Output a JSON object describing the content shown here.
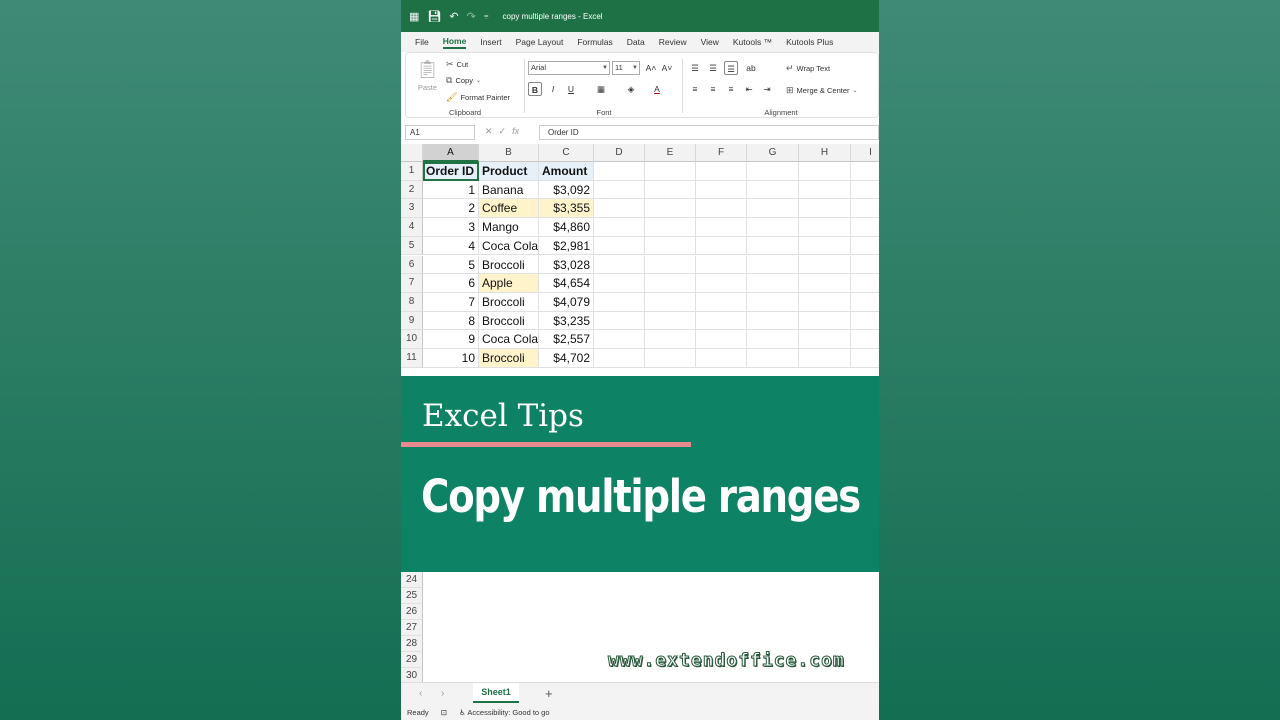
{
  "app": {
    "doc_title": "copy multiple ranges",
    "app_name": "Excel",
    "title_sep": "-"
  },
  "ribbon": {
    "tabs": [
      "File",
      "Home",
      "Insert",
      "Page Layout",
      "Formulas",
      "Data",
      "Review",
      "View",
      "Kutools ™",
      "Kutools Plus"
    ],
    "active_tab": "Home",
    "clipboard": {
      "paste": "Paste",
      "cut": "Cut",
      "copy": "Copy",
      "format_painter": "Format Painter",
      "label": "Clipboard"
    },
    "font": {
      "name": "Arial",
      "size": "11",
      "label": "Font",
      "bold": "B",
      "italic": "I",
      "underline": "U"
    },
    "alignment": {
      "wrap_text": "Wrap Text",
      "merge_center": "Merge & Center",
      "label": "Alignment"
    }
  },
  "formula_bar": {
    "name_box": "A1",
    "fx": "fx",
    "value": "Order ID"
  },
  "columns": [
    "A",
    "B",
    "C",
    "D",
    "E",
    "F",
    "G",
    "H",
    "I"
  ],
  "table": {
    "headers": [
      "Order ID",
      "Product",
      "Amount"
    ],
    "rows": [
      {
        "row": "2",
        "id": "1",
        "product": "Banana",
        "amount": "$3,092",
        "hl": false
      },
      {
        "row": "3",
        "id": "2",
        "product": "Coffee",
        "amount": "$3,355",
        "hl": true
      },
      {
        "row": "4",
        "id": "3",
        "product": "Mango",
        "amount": "$4,860",
        "hl": false
      },
      {
        "row": "5",
        "id": "4",
        "product": "Coca Cola",
        "amount": "$2,981",
        "hl": false
      },
      {
        "row": "6",
        "id": "5",
        "product": "Broccoli",
        "amount": "$3,028",
        "hl": false
      },
      {
        "row": "7",
        "id": "6",
        "product": "Apple",
        "amount": "$4,654",
        "hl": "product"
      },
      {
        "row": "8",
        "id": "7",
        "product": "Broccoli",
        "amount": "$4,079",
        "hl": false
      },
      {
        "row": "9",
        "id": "8",
        "product": "Broccoli",
        "amount": "$3,235",
        "hl": false
      },
      {
        "row": "10",
        "id": "9",
        "product": "Coca Cola",
        "amount": "$2,557",
        "hl": false
      },
      {
        "row": "11",
        "id": "10",
        "product": "Broccoli",
        "amount": "$4,702",
        "hl": "product"
      }
    ]
  },
  "lower_rows": [
    "24",
    "25",
    "26",
    "27",
    "28",
    "29",
    "30"
  ],
  "banner": {
    "kicker": "Excel Tips",
    "headline": "Copy multiple ranges"
  },
  "watermark": "www.extendoffice.com",
  "sheets": {
    "active": "Sheet1",
    "add": "+"
  },
  "status": {
    "ready": "Ready",
    "accessibility": "Accessibility: Good to go"
  },
  "colors": {
    "excel_green": "#1e7145",
    "banner": "#0e8264",
    "highlight": "#fff3cc",
    "accent_line": "#e88a8d"
  }
}
